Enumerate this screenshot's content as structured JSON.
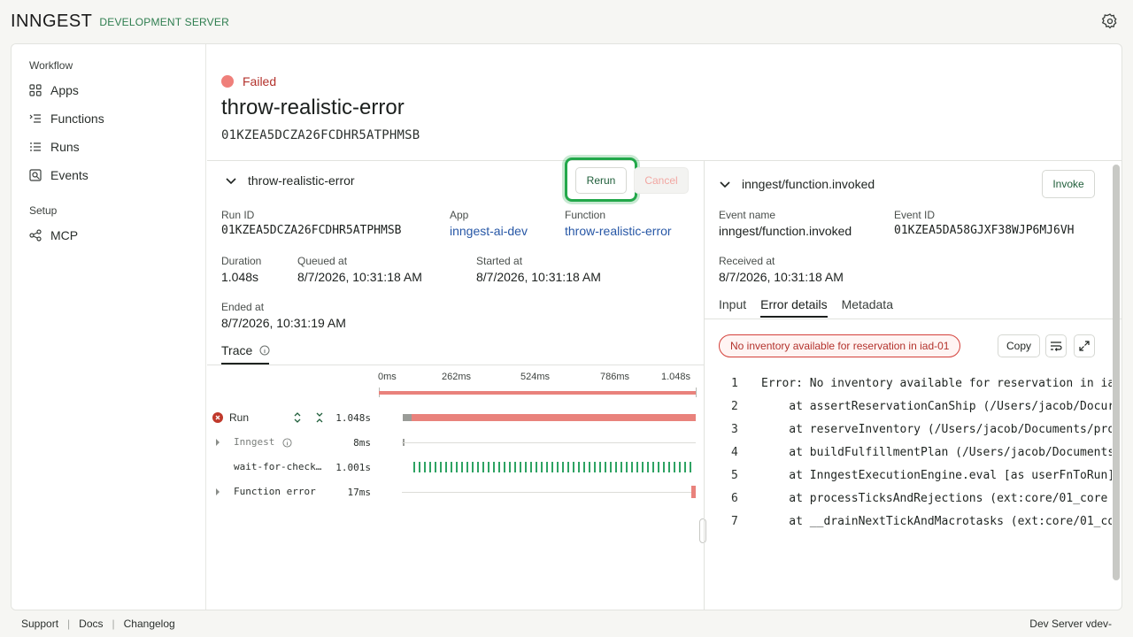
{
  "header": {
    "logo": "INNGEST",
    "env_label": "DEVELOPMENT SERVER"
  },
  "sidebar": {
    "sections": [
      {
        "label": "Workflow",
        "items": [
          {
            "label": "Apps",
            "icon": "grid-icon"
          },
          {
            "label": "Functions",
            "icon": "list-icon"
          },
          {
            "label": "Runs",
            "icon": "lines-icon"
          },
          {
            "label": "Events",
            "icon": "search-doc-icon"
          }
        ]
      },
      {
        "label": "Setup",
        "items": [
          {
            "label": "MCP",
            "icon": "share-icon"
          }
        ]
      }
    ]
  },
  "run": {
    "status": "Failed",
    "title": "throw-realistic-error",
    "id": "01KZEA5DCZA26FCDHR5ATPHMSB"
  },
  "function_panel": {
    "name": "throw-realistic-error",
    "rerun_label": "Rerun",
    "cancel_label": "Cancel",
    "fields": {
      "run_id_label": "Run ID",
      "run_id": "01KZEA5DCZA26FCDHR5ATPHMSB",
      "app_label": "App",
      "app": "inngest-ai-dev",
      "function_label": "Function",
      "function": "throw-realistic-error",
      "duration_label": "Duration",
      "duration": "1.048s",
      "queued_label": "Queued at",
      "queued": "8/7/2026, 10:31:18 AM",
      "started_label": "Started at",
      "started": "8/7/2026, 10:31:18 AM",
      "ended_label": "Ended at",
      "ended": "8/7/2026, 10:31:19 AM"
    },
    "trace_tab": "Trace",
    "trace_ticks": [
      "0ms",
      "262ms",
      "524ms",
      "786ms",
      "1.048s"
    ],
    "trace_rows": [
      {
        "name": "Run",
        "duration": "1.048s"
      },
      {
        "name": "Inngest",
        "duration": "8ms"
      },
      {
        "name": "wait-for-check…",
        "duration": "1.001s"
      },
      {
        "name": "Function error",
        "duration": "17ms"
      }
    ]
  },
  "event_panel": {
    "name": "inngest/function.invoked",
    "invoke_label": "Invoke",
    "event_name_label": "Event name",
    "event_name": "inngest/function.invoked",
    "event_id_label": "Event ID",
    "event_id": "01KZEA5DA58GJXF38WJP6MJ6VH",
    "received_label": "Received at",
    "received": "8/7/2026, 10:31:18 AM",
    "tabs": [
      "Input",
      "Error details",
      "Metadata"
    ],
    "active_tab": "Error details",
    "error_badge": "No inventory available for reservation in iad-01",
    "copy_label": "Copy",
    "code_lines": [
      {
        "n": "1",
        "text": "Error: No inventory available for reservation in ia"
      },
      {
        "n": "2",
        "text": "    at assertReservationCanShip (/Users/jacob/Docur"
      },
      {
        "n": "3",
        "text": "    at reserveInventory (/Users/jacob/Documents/pro"
      },
      {
        "n": "4",
        "text": "    at buildFulfillmentPlan (/Users/jacob/Documents"
      },
      {
        "n": "5",
        "text": "    at InngestExecutionEngine.eval [as userFnToRun]"
      },
      {
        "n": "6",
        "text": "    at processTicksAndRejections (ext:core/01_core"
      },
      {
        "n": "7",
        "text": "    at __drainNextTickAndMacrotasks (ext:core/01_co"
      }
    ]
  },
  "footer": {
    "links": [
      "Support",
      "Docs",
      "Changelog"
    ],
    "version": "Dev Server vdev-"
  },
  "colors": {
    "accent": "#22a84a",
    "error": "#e9827c",
    "status": "#ef7f7a",
    "link": "#2757a6"
  }
}
